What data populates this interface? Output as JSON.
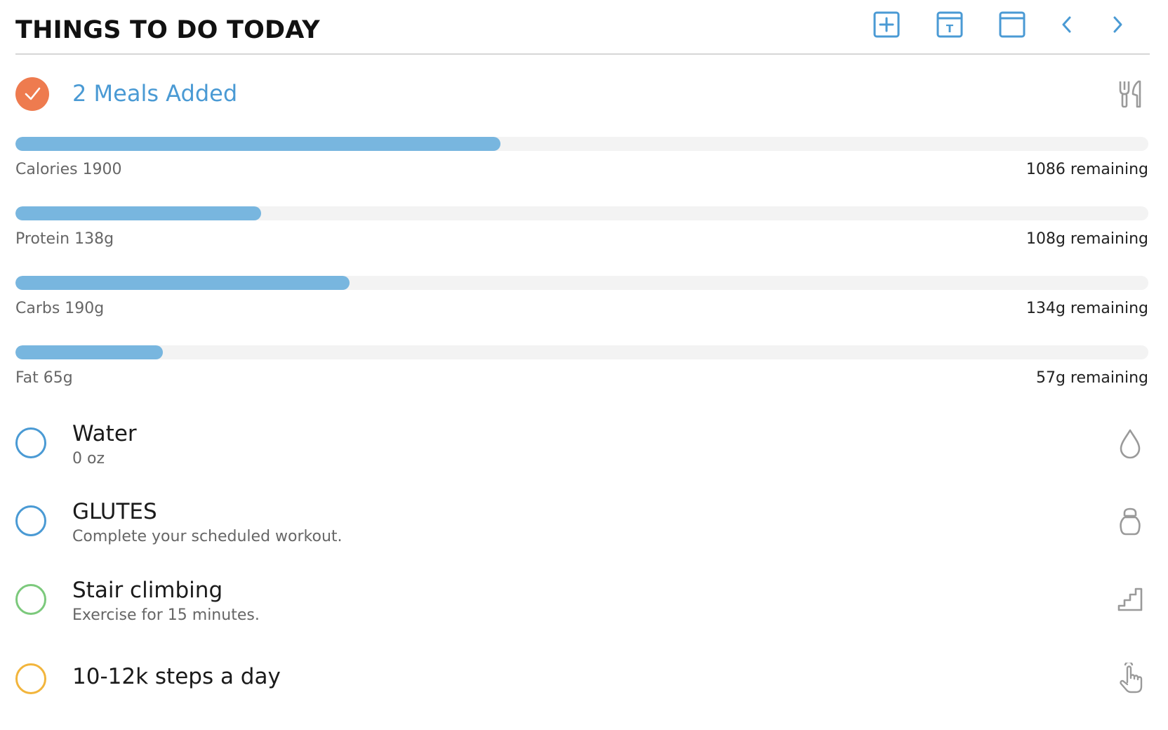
{
  "header": {
    "title": "THINGS TO DO TODAY",
    "buttons": [
      {
        "name": "add-icon"
      },
      {
        "name": "calendar-today-icon",
        "glyph": "T"
      },
      {
        "name": "calendar-icon"
      },
      {
        "name": "chevron-left-icon"
      },
      {
        "name": "chevron-right-icon"
      }
    ],
    "accent_color": "#4a9ad4"
  },
  "meals": {
    "label": "2 Meals Added",
    "checked": true,
    "check_color": "#ee7b4f",
    "icon": "utensils-icon"
  },
  "nutrition": [
    {
      "label": "Calories 1900",
      "remaining": "1086 remaining",
      "progress": 0.428
    },
    {
      "label": "Protein 138g",
      "remaining": "108g remaining",
      "progress": 0.217
    },
    {
      "label": "Carbs 190g",
      "remaining": "134g remaining",
      "progress": 0.295
    },
    {
      "label": "Fat 65g",
      "remaining": "57g remaining",
      "progress": 0.13
    }
  ],
  "bar_color": "#78b6df",
  "tasks": [
    {
      "title": "Water",
      "subtitle": "0 oz",
      "circle_color": "#4a9ad4",
      "icon": "water-drop-icon"
    },
    {
      "title": "GLUTES",
      "subtitle": "Complete your scheduled workout.",
      "circle_color": "#4a9ad4",
      "icon": "kettlebell-icon"
    },
    {
      "title": "Stair climbing",
      "subtitle": "Exercise for 15 minutes.",
      "circle_color": "#7cc97c",
      "icon": "stairs-icon"
    },
    {
      "title": "10-12k steps a day",
      "subtitle": "",
      "circle_color": "#f2b53c",
      "icon": "tap-hand-icon"
    }
  ]
}
